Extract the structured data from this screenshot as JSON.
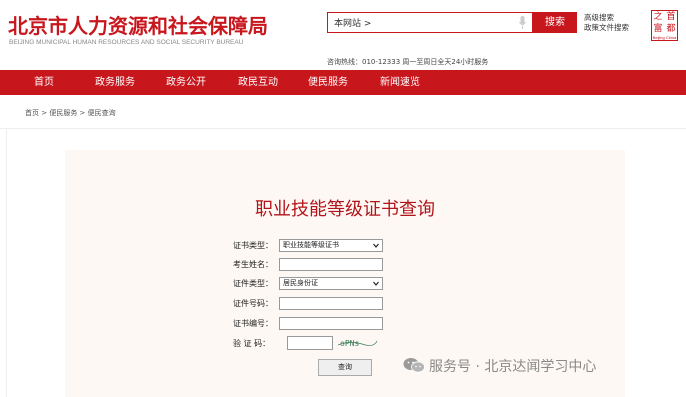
{
  "header": {
    "title": "北京市人力资源和社会保障局",
    "subtitle": "BEIJING MUNICIPAL HUMAN RESOURCES AND SOCIAL SECURITY BUREAU",
    "search_scope": "本网站 >",
    "search_button": "搜索",
    "advanced_search": "高级搜索",
    "policy_search": "政策文件搜索",
    "emblem_chars": [
      "之",
      "首",
      "富",
      "都"
    ],
    "emblem_caption": "Beijing China",
    "hotline": "咨询热线：010-12333 周一至周日全天24小时服务"
  },
  "nav": {
    "items": [
      "首页",
      "政务服务",
      "政务公开",
      "政民互动",
      "便民服务",
      "新闻速览"
    ]
  },
  "breadcrumb": "首页 > 便民服务 > 便民查询",
  "form": {
    "title": "职业技能等级证书查询",
    "cert_type_label": "证书类型：",
    "cert_type_value": "职业技能等级证书",
    "name_label": "考生姓名：",
    "id_type_label": "证件类型：",
    "id_type_value": "居民身份证",
    "id_number_label": "证件号码：",
    "cert_number_label": "证书编号：",
    "captcha_label": "验  证  码：",
    "captcha_text": "oPNs",
    "query_button": "查询"
  },
  "watermark": {
    "text": "服务号 · 北京达闻学习中心",
    "icon": "wechat-icon"
  },
  "colors": {
    "brand_red": "#c8161d",
    "title_red": "#b3141b",
    "panel_bg": "#fdf8f3"
  }
}
